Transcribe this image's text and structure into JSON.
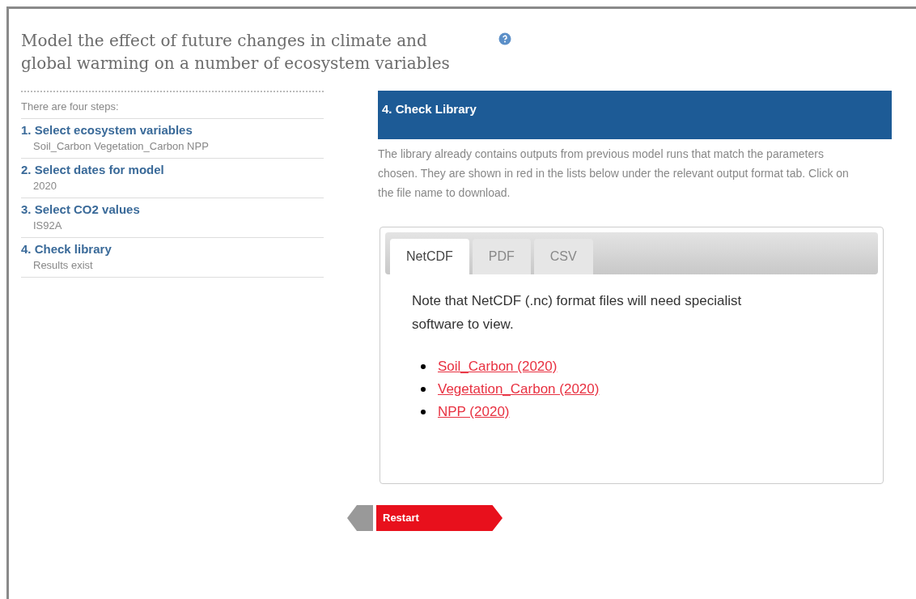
{
  "title": "Model the effect of future changes in climate and global warming on a number of ecosystem variables",
  "sidebar": {
    "intro": "There are four steps:",
    "steps": [
      {
        "title": "1. Select ecosystem variables",
        "value": "Soil_Carbon Vegetation_Carbon NPP"
      },
      {
        "title": "2. Select dates for model",
        "value": "2020"
      },
      {
        "title": "3. Select CO2 values",
        "value": "IS92A"
      },
      {
        "title": "4. Check library",
        "value": "Results exist"
      }
    ]
  },
  "panel": {
    "heading": "4. Check Library",
    "description": "The library already contains outputs from previous model runs that match the parameters chosen. They are shown in red in the lists below under the relevant output format tab. Click on the file name to download.",
    "tabs": [
      {
        "label": "NetCDF",
        "selected": true
      },
      {
        "label": "PDF",
        "selected": false
      },
      {
        "label": "CSV",
        "selected": false
      }
    ],
    "note": "Note that NetCDF (.nc) format files will need specialist software to view.",
    "files": [
      "Soil_Carbon (2020)",
      "Vegetation_Carbon (2020)",
      "NPP (2020)"
    ]
  },
  "restart_button": "Restart"
}
